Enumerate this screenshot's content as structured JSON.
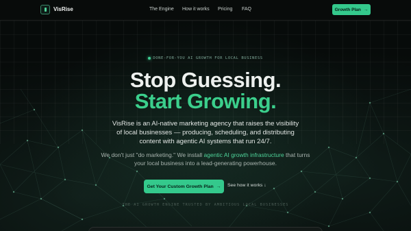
{
  "nav": {
    "brand": "VisRise",
    "links": [
      "The Engine",
      "How it works",
      "Pricing",
      "FAQ"
    ],
    "cta_label": "Growth Plan",
    "cta_arrow": "→"
  },
  "hero": {
    "eyebrow": "DONE-FOR-YOU AI GROWTH FOR LOCAL BUSINESS",
    "headline_line1": "Stop Guessing.",
    "headline_line2": "Start Growing.",
    "description": "VisRise is an AI-native marketing agency that raises the visibility of local businesses — producing, scheduling, and distributing content with agentic AI systems that run 24/7.",
    "sub_before": "We don't just \"do marketing.\" We install ",
    "sub_highlight": "agentic AI growth infrastructure",
    "sub_after": " that turns your local business into a lead-generating powerhouse.",
    "cta_label": "Get Your Custom Growth Plan",
    "cta_arrow": "→",
    "secondary_label": "See how it works ↓",
    "trusted_text": "THE AI GROWTH ENGINE TRUSTED BY AMBITIOUS LOCAL BUSINESSES"
  },
  "colors": {
    "accent": "#34c98c",
    "background": "#070b0a"
  }
}
